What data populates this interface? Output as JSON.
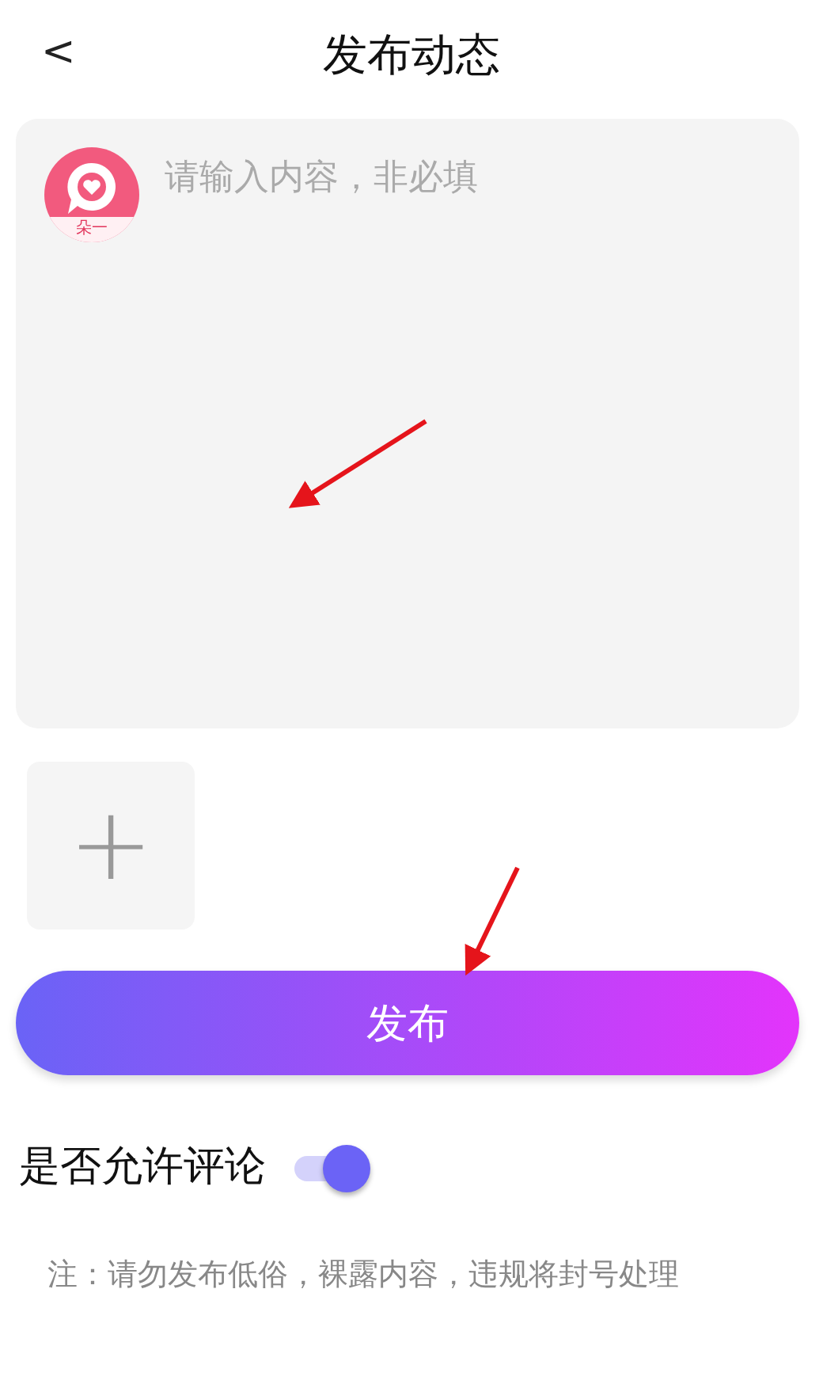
{
  "header": {
    "back": "<",
    "title": "发布动态"
  },
  "composer": {
    "avatar_label": "朵一",
    "placeholder": "请输入内容，非必填"
  },
  "add_image": {
    "icon": "+"
  },
  "submit": {
    "label": "发布"
  },
  "comment_setting": {
    "label": "是否允许评论",
    "on": true
  },
  "note": "注：请勿发布低俗，裸露内容，违规将封号处理"
}
